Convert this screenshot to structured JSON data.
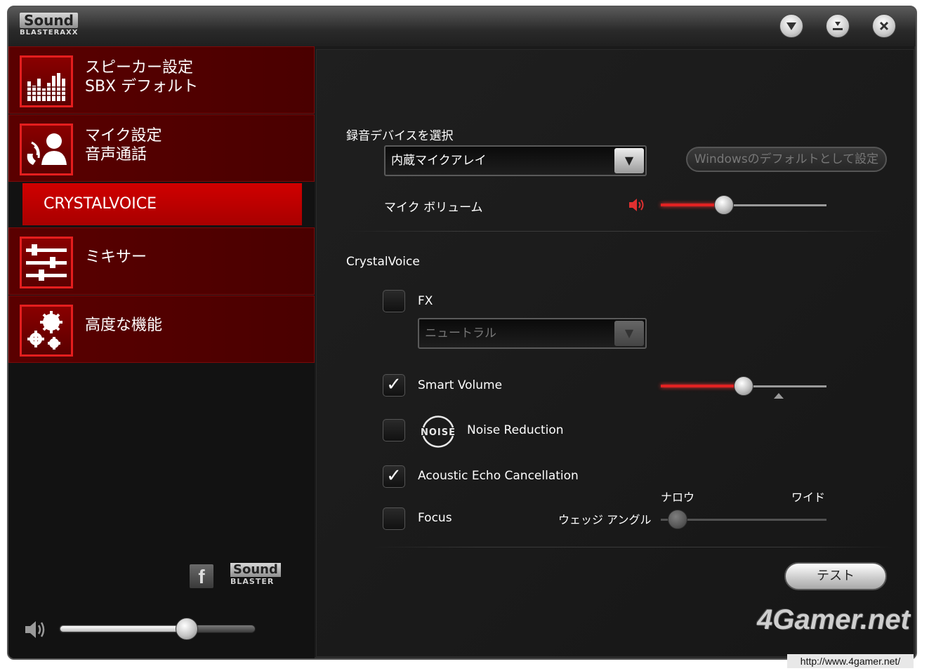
{
  "titlebar": {
    "logo_main": "Sound",
    "logo_sub": "BLASTERAXX",
    "buttons": [
      "menu",
      "minimize",
      "close"
    ]
  },
  "sidebar": {
    "items": [
      {
        "line1": "スピーカー設定",
        "line2": "SBX デフォルト",
        "icon": "speaker-bars-icon"
      },
      {
        "line1": "マイク設定",
        "line2": "音声通話",
        "icon": "voice-user-icon"
      },
      {
        "line1": "ミキサー",
        "line2": "",
        "icon": "mixer-sliders-icon"
      },
      {
        "line1": "高度な機能",
        "line2": "",
        "icon": "gears-icon"
      }
    ],
    "sub_selected": "CRYSTALVOICE",
    "footer_logo_main": "Sound",
    "footer_logo_sub": "BLASTER",
    "master_volume": 0.65
  },
  "main": {
    "record_device_label": "録音デバイスを選択",
    "record_device_value": "内蔵マイクアレイ",
    "default_button": "Windowsのデフォルトとして設定",
    "mic_volume_label": "マイク ボリューム",
    "mic_volume": 0.38,
    "section_title": "CrystalVoice",
    "fx_label": "FX",
    "fx_checked": false,
    "fx_preset": "ニュートラル",
    "smart_volume_label": "Smart Volume",
    "smart_volume_checked": true,
    "smart_volume_level": 0.5,
    "noise_reduction_label": "Noise Reduction",
    "noise_reduction_checked": false,
    "noise_badge": "NOISE",
    "aec_label": "Acoustic Echo Cancellation",
    "aec_checked": true,
    "focus_label": "Focus",
    "focus_checked": false,
    "wedge_label": "ウェッジ アングル",
    "narrow_label": "ナロウ",
    "wide_label": "ワイド",
    "wedge_angle": 0.1,
    "test_button": "テスト"
  },
  "watermark": {
    "brand": "4Gamer.net",
    "url": "http://www.4gamer.net/"
  },
  "colors": {
    "accent_red": "#d00000",
    "nav_red": "#5a0000"
  }
}
